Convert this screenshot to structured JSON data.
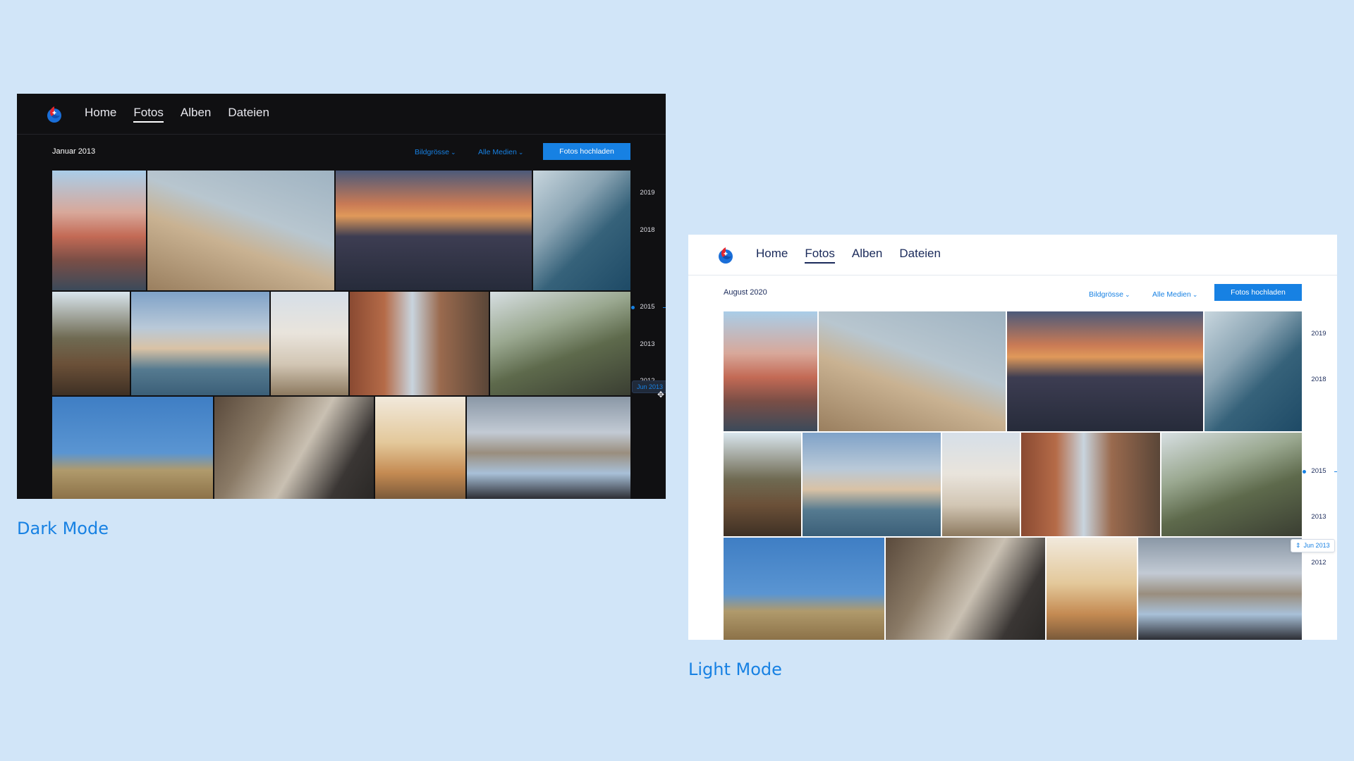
{
  "colors": {
    "background": "#d1e5f8",
    "accent": "#1781e3",
    "dark_bg": "#101012",
    "light_bg": "#ffffff",
    "logo_red": "#e3262e",
    "logo_blue": "#1a6ed8"
  },
  "nav": {
    "items": [
      {
        "label": "Home"
      },
      {
        "label": "Fotos"
      },
      {
        "label": "Alben"
      },
      {
        "label": "Dateien"
      }
    ],
    "active": "Fotos"
  },
  "dark": {
    "date_label": "Januar 2013",
    "filters": {
      "size_label": "Bildgrösse",
      "media_label": "Alle Medien"
    },
    "upload_label": "Fotos hochladen",
    "timeline": [
      "2019",
      "2018",
      "2015",
      "2013",
      "2012"
    ],
    "scrub_label": "Jun 2013",
    "caption": "Dark Mode"
  },
  "light": {
    "date_label": "August 2020",
    "filters": {
      "size_label": "Bildgrösse",
      "media_label": "Alle Medien"
    },
    "upload_label": "Fotos hochladen",
    "timeline": [
      "2019",
      "2018",
      "2015",
      "2013",
      "2012"
    ],
    "scrub_label": "Jun 2013",
    "caption": "Light Mode"
  },
  "photos": [
    {
      "name": "cinque-terre-cliff-village"
    },
    {
      "name": "colosseum-arches"
    },
    {
      "name": "vernazza-sunset"
    },
    {
      "name": "coastal-cliffs-sea"
    },
    {
      "name": "archway-pine-trees"
    },
    {
      "name": "venice-grand-canal"
    },
    {
      "name": "white-hilltop-town"
    },
    {
      "name": "venice-narrow-canal"
    },
    {
      "name": "woman-under-tree"
    },
    {
      "name": "blue-sky-field"
    },
    {
      "name": "car-mirror-feet"
    },
    {
      "name": "leaning-tower-pisa"
    },
    {
      "name": "road-trip-map"
    }
  ]
}
